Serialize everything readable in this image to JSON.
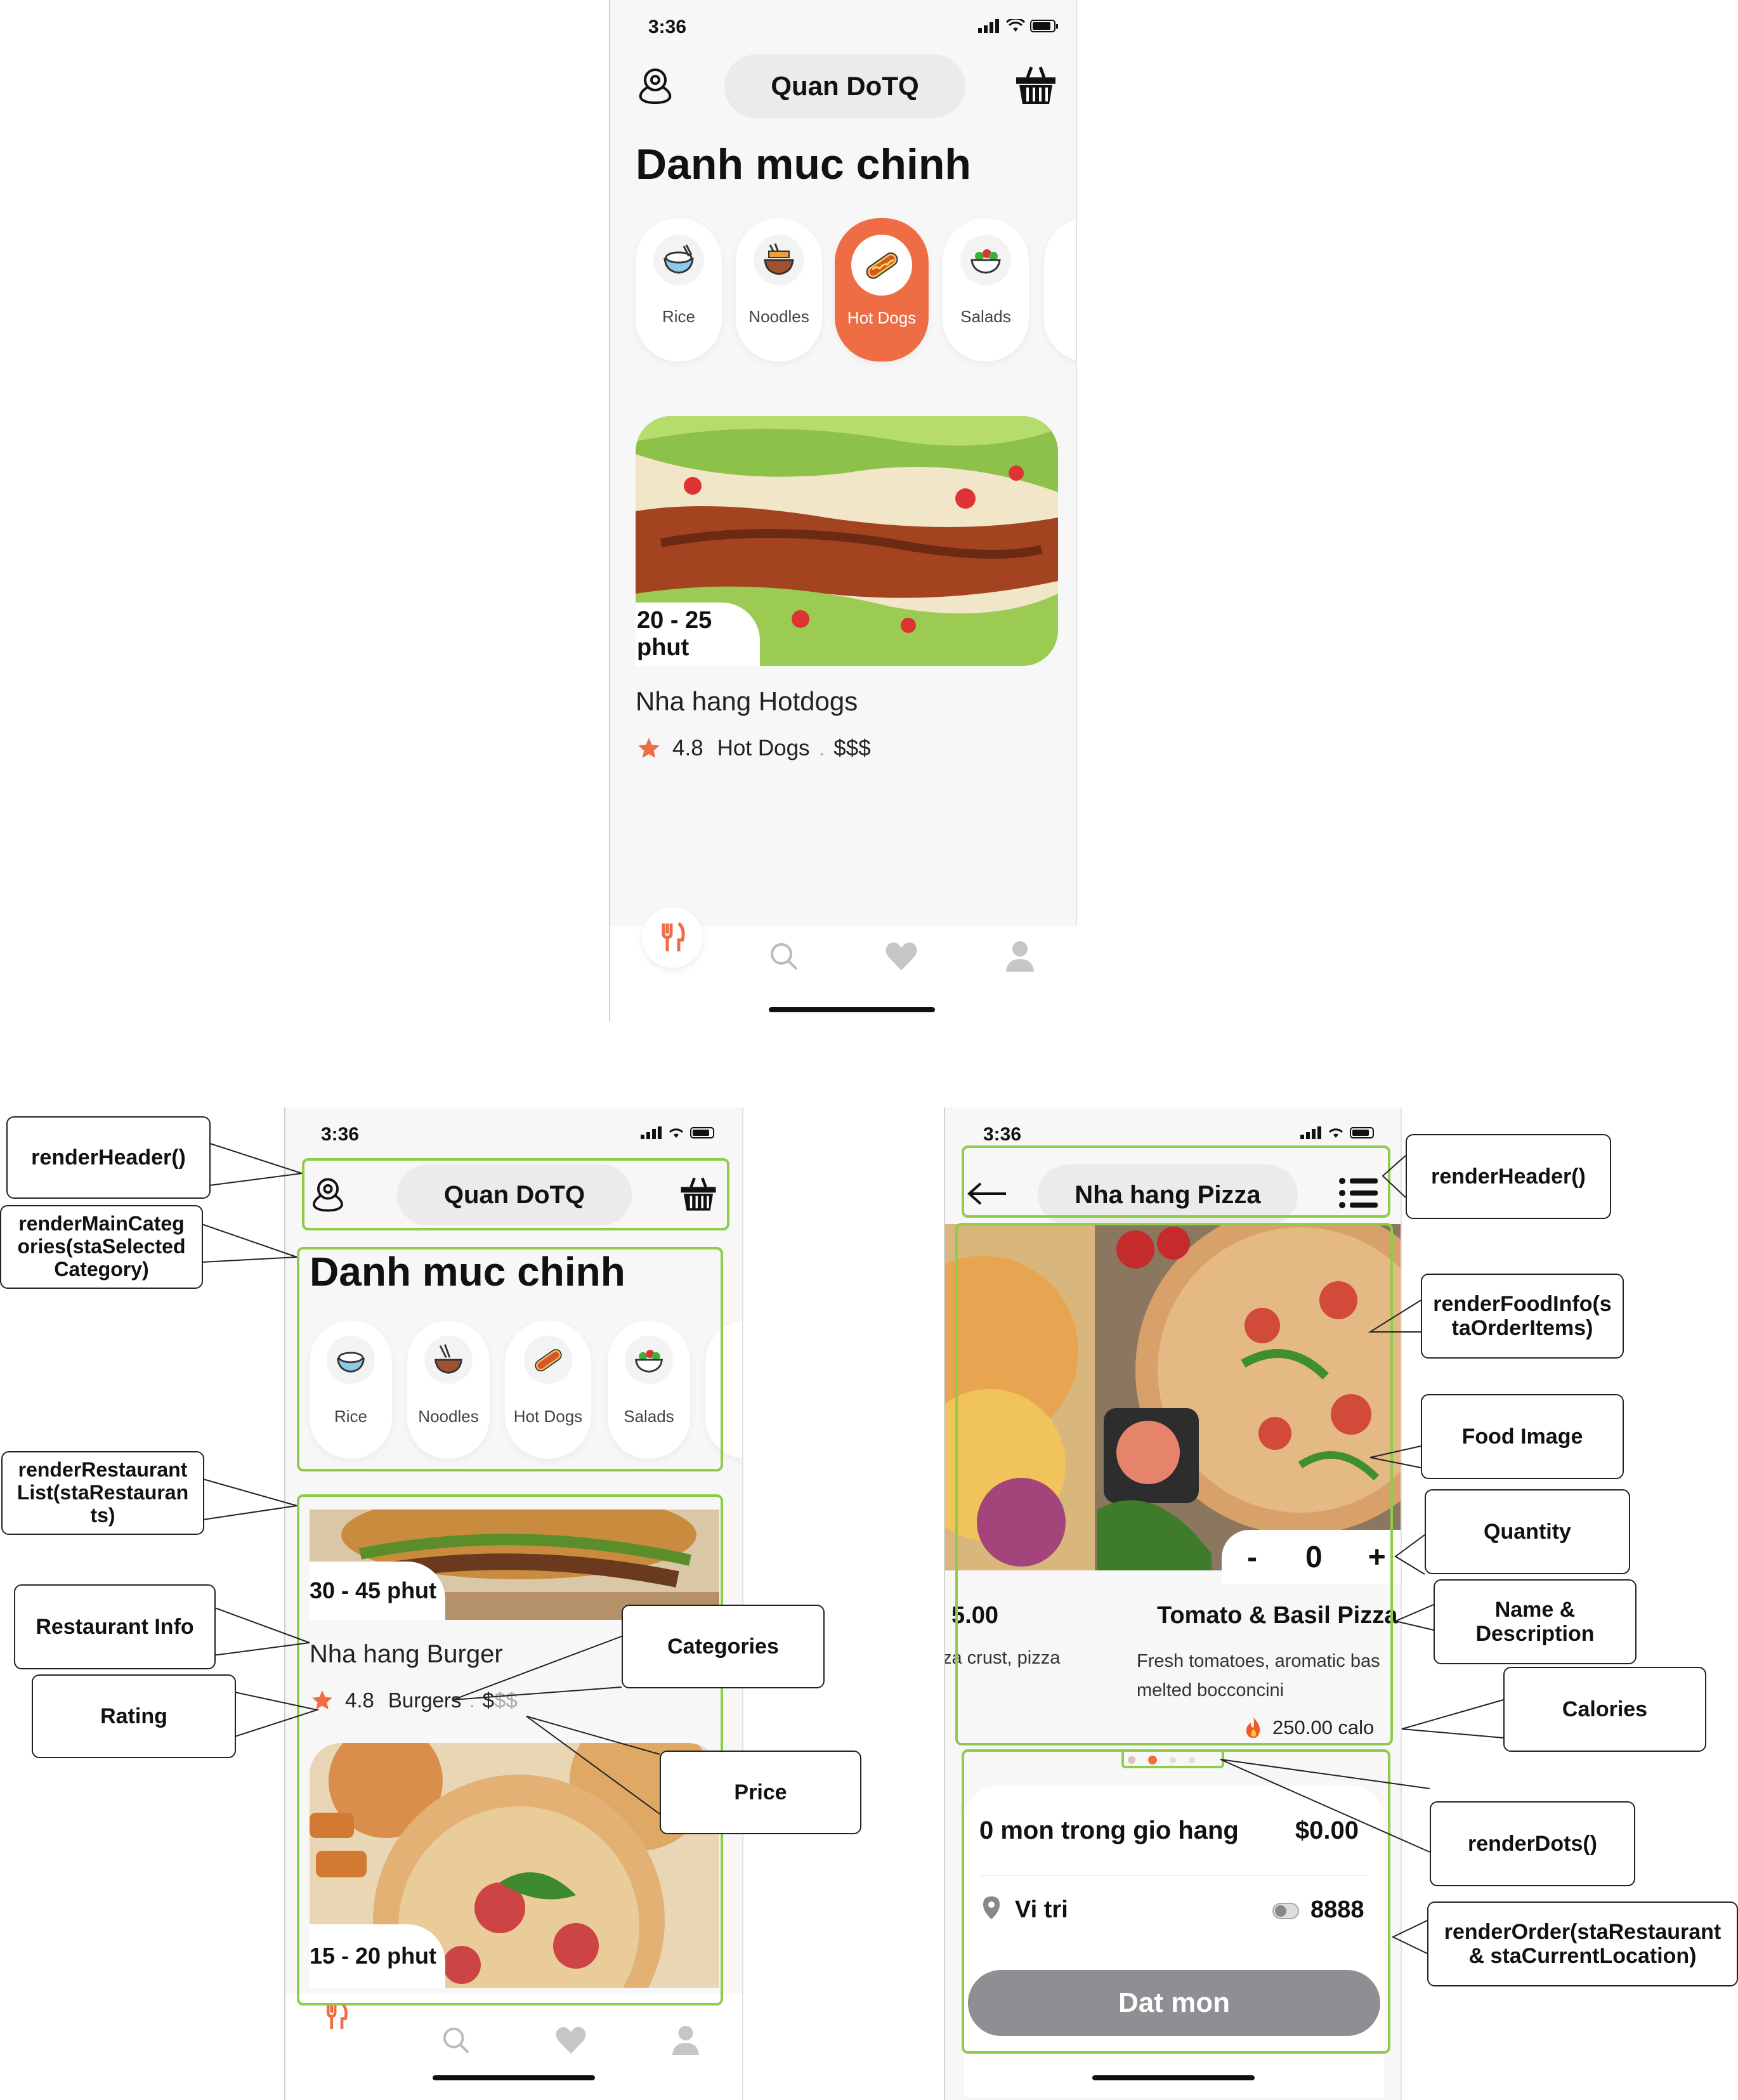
{
  "status": {
    "time": "3:36"
  },
  "home": {
    "header_title": "Quan DoTQ",
    "section_title": "Danh muc chinh",
    "categories": [
      {
        "label": "Rice",
        "icon": "rice-bowl-icon"
      },
      {
        "label": "Noodles",
        "icon": "noodles-icon"
      },
      {
        "label": "Hot Dogs",
        "icon": "hotdog-icon"
      },
      {
        "label": "Salads",
        "icon": "salad-icon"
      }
    ],
    "selected_category": "Hot Dogs",
    "restaurant": {
      "time": "20 - 25 phut",
      "name": "Nha hang Hotdogs",
      "rating": "4.8",
      "category": "Hot Dogs",
      "price_active": "$",
      "price_rest": "$$",
      "separator": "."
    }
  },
  "annotated_home": {
    "header_title": "Quan DoTQ",
    "section_title": "Danh muc chinh",
    "categories": [
      "Rice",
      "Noodles",
      "Hot Dogs",
      "Salads"
    ],
    "restaurants": [
      {
        "time": "30 - 45 phut",
        "name": "Nha hang Burger",
        "rating": "4.8",
        "category": "Burgers",
        "price_active": "$",
        "price_rest": "$$"
      },
      {
        "time": "15 - 20 phut"
      }
    ]
  },
  "detail": {
    "header_title": "Nha hang Pizza",
    "prev_item": {
      "price": "5.00",
      "desc": "za crust, pizza"
    },
    "item": {
      "name": "Tomato & Basil Pizza",
      "desc_line1": "Fresh tomatoes, aromatic bas",
      "desc_line2": "melted bocconcini",
      "calories": "250.00 calo"
    },
    "quantity": {
      "minus": "-",
      "value": "0",
      "plus": "+"
    },
    "cart": {
      "summary": "0 mon trong gio hang",
      "total": "$0.00"
    },
    "location": {
      "label": "Vi tri",
      "value": "8888"
    },
    "order_button": "Dat mon"
  },
  "annotations": {
    "render_header": "renderHeader()",
    "render_main_categories": "renderMainCategories(staSelectedCategory)",
    "render_main_categories_lines": [
      "renderMainCateg",
      "ories(staSelected",
      "Category)"
    ],
    "render_restaurant_list_lines": [
      "renderRestaurant",
      "List(staRestauran",
      "ts)"
    ],
    "restaurant_info": "Restaurant Info",
    "rating": "Rating",
    "categories": "Categories",
    "price": "Price",
    "render_header_right": "renderHeader()",
    "render_food_info_lines": [
      "renderFoodInfo(s",
      "taOrderItems)"
    ],
    "food_image": "Food Image",
    "quantity": "Quantity",
    "name_desc_lines": [
      "Name &",
      "Description"
    ],
    "calories": "Calories",
    "render_dots": "renderDots()",
    "render_order_lines": [
      "renderOrder(staRestaurant",
      "& staCurrentLocation)"
    ]
  },
  "colors": {
    "accent": "#ee6d45",
    "annotation_box": "#8fcc4a",
    "button_gray": "#8e8e93"
  }
}
